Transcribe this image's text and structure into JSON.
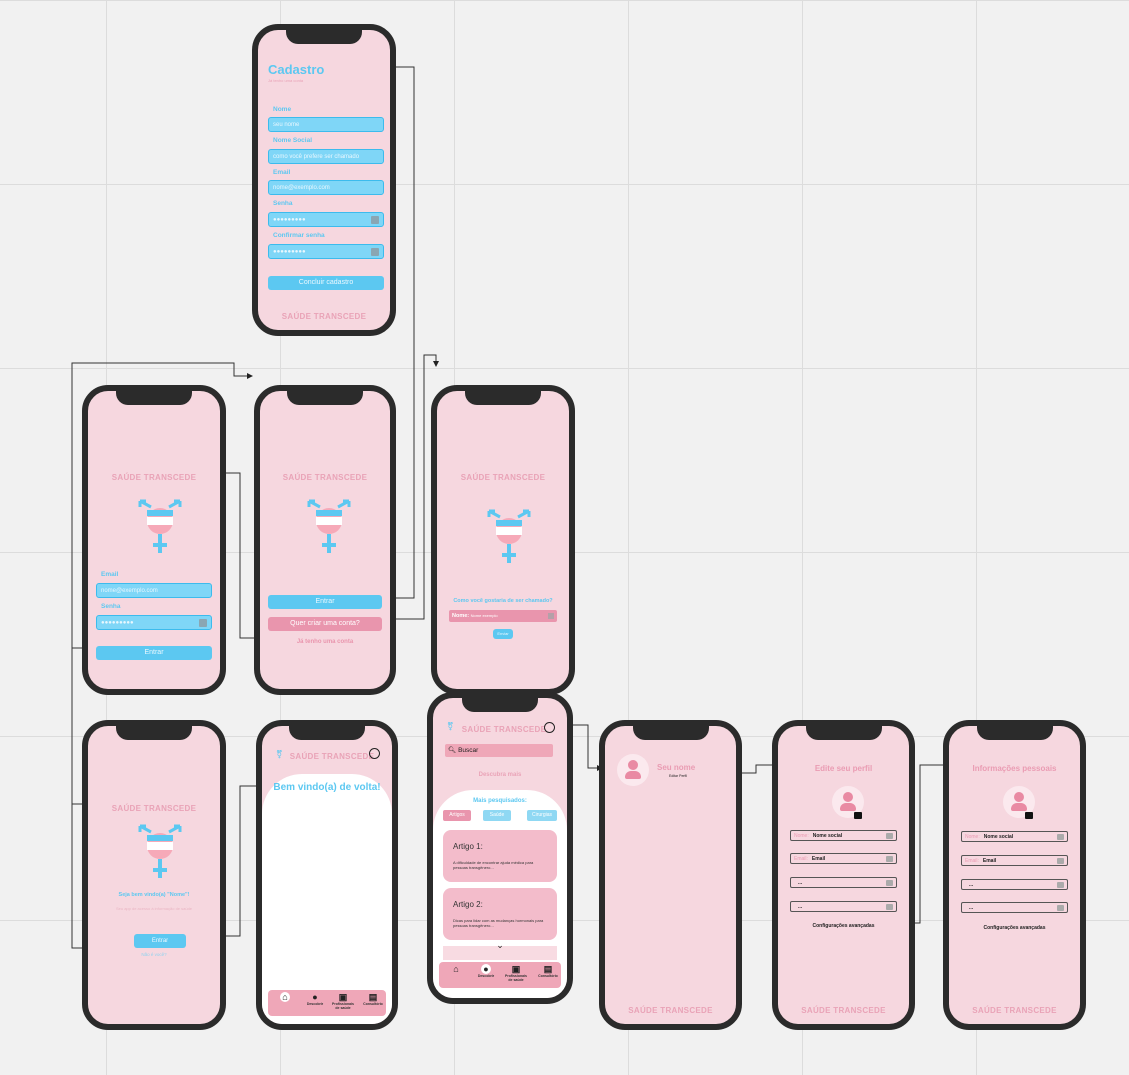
{
  "brand": "SAÚDE TRANSCEDE",
  "cadastro": {
    "title": "Cadastro",
    "subtitle": "Já tenho uma conta",
    "fields": [
      {
        "label": "Nome",
        "placeholder": "seu nome"
      },
      {
        "label": "Nome Social",
        "placeholder": "como você prefere ser chamado"
      },
      {
        "label": "Email",
        "placeholder": "nome@exemplo.com"
      },
      {
        "label": "Senha",
        "placeholder": "●●●●●●●●●"
      },
      {
        "label": "Confirmar senha",
        "placeholder": "●●●●●●●●●"
      }
    ],
    "submit": "Concluir cadastro"
  },
  "login": {
    "email_label": "Email",
    "email_placeholder": "nome@exemplo.com",
    "senha_label": "Senha",
    "senha_placeholder": "●●●●●●●●●",
    "enter": "Entrar"
  },
  "welcome": {
    "enter": "Entrar",
    "create": "Quer criar uma conta?",
    "have_account": "Já tenho uma conta"
  },
  "name_screen": {
    "question": "Como você gostaria de ser chamado?",
    "field_label": "Nome:",
    "field_value": "Nome exemplo",
    "button": "Enviar"
  },
  "greet": {
    "title": "Seja bem vindo(a) \"Nome\"!",
    "subtitle": "Seu app de acesso à informação de saúde",
    "enter": "Entrar",
    "skip": "Não é você?"
  },
  "home": {
    "title": "Bem vindo(a) de volta!"
  },
  "discover": {
    "search_placeholder": "Buscar",
    "heading": "Descubra mais",
    "most_searched": "Mais pesquisados:",
    "chips": [
      "Artigos",
      "Saúde",
      "Cirurgias"
    ],
    "articles": [
      {
        "title": "Artigo 1:",
        "text": "A dificuldade de encontrar ajuda médica para pessoas transgênero..."
      },
      {
        "title": "Artigo 2:",
        "text": "Dicas para lidar com as mudanças hormonais para pessoas transgênero..."
      }
    ]
  },
  "tabs": [
    "Descobrir",
    "Profissionais de saúde",
    "Consultório"
  ],
  "profile": {
    "name": "Seu nome",
    "edit": "Editar Perfil"
  },
  "edit_profile": {
    "title": "Edite seu perfil",
    "fields": [
      {
        "placeholder": "Nome:",
        "value": "Nome social"
      },
      {
        "placeholder": "Email:",
        "value": "Email"
      },
      {
        "placeholder": "",
        "value": "..."
      },
      {
        "placeholder": "",
        "value": "..."
      }
    ],
    "advanced": "Configurações avançadas"
  },
  "personal_info": {
    "title": "Informações pessoais",
    "fields": [
      {
        "placeholder": "Nome:",
        "value": "Nome social"
      },
      {
        "placeholder": "Email:",
        "value": "Email"
      },
      {
        "placeholder": "",
        "value": "..."
      },
      {
        "placeholder": "",
        "value": "..."
      }
    ],
    "advanced": "Configurações avançadas"
  }
}
